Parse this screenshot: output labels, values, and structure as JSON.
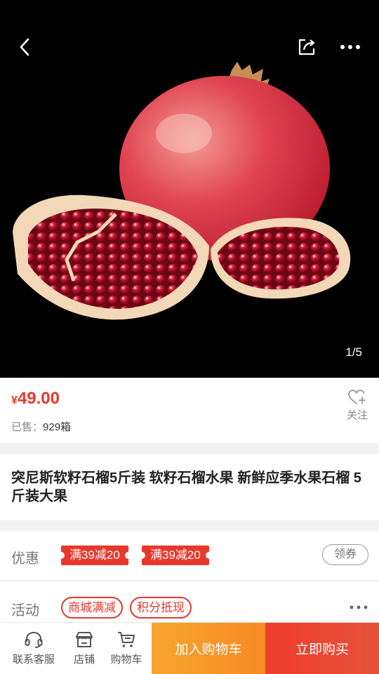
{
  "hero": {
    "pager": "1/5",
    "image_subject": "pomegranate"
  },
  "price": {
    "currency": "¥",
    "amount": "49.00",
    "sold_label": "已售：",
    "sold_value": "929箱",
    "follow_label": "关注"
  },
  "product": {
    "title": "突尼斯软籽石榴5斤装 软籽石榴水果 新鲜应季水果石榴 5斤装大果"
  },
  "promo": {
    "label": "优惠",
    "coupons": [
      "满39减20",
      "满39减20"
    ],
    "claim_label": "领券"
  },
  "activity": {
    "label": "活动",
    "tags": [
      "商城满减",
      "积分抵现"
    ]
  },
  "bottom_bar": {
    "service_label": "联系客服",
    "shop_label": "店铺",
    "cart_label": "购物车",
    "add_to_cart_label": "加入购物车",
    "buy_now_label": "立即购买"
  },
  "colors": {
    "accent_red": "#e8382c",
    "orange": "#f7a531"
  }
}
